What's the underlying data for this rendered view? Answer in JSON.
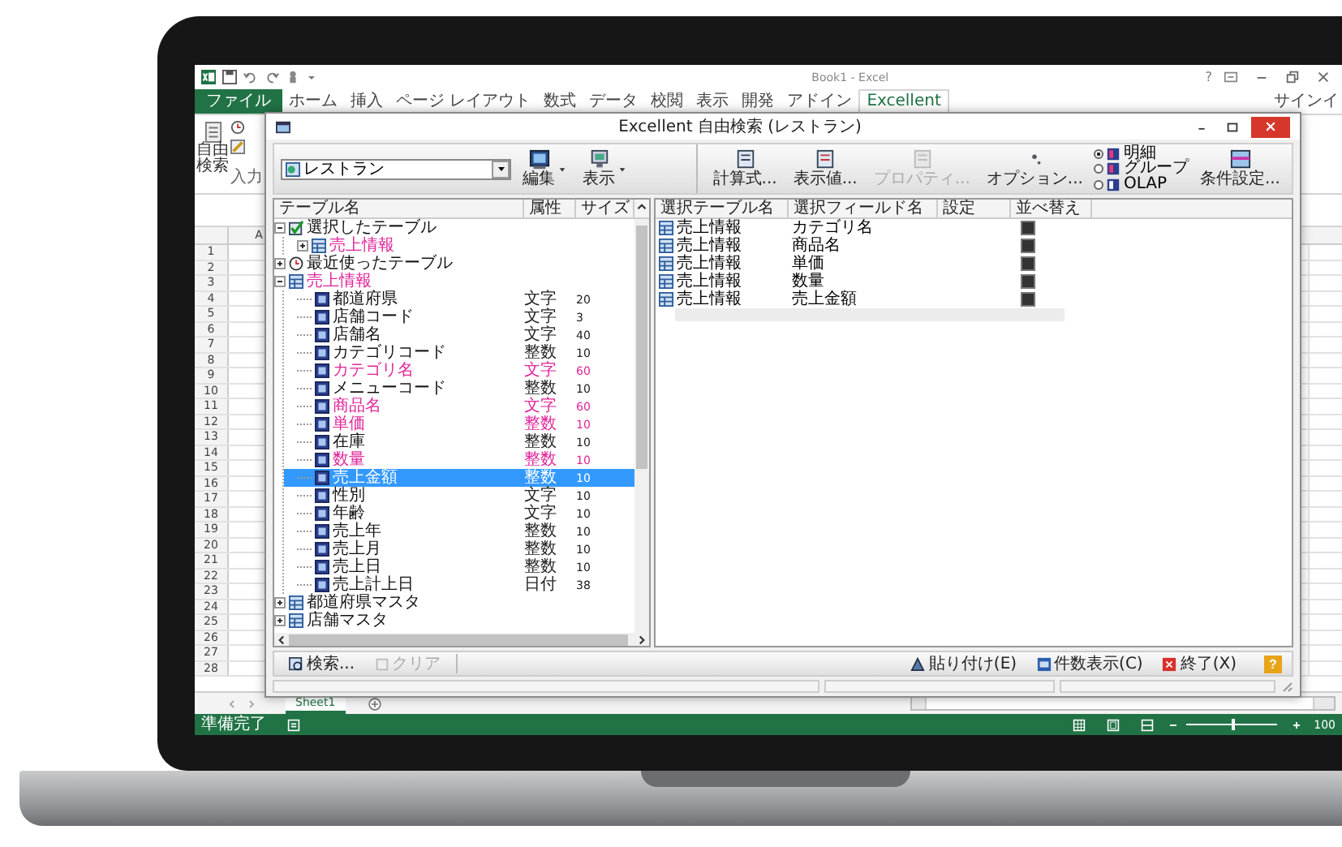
{
  "excel": {
    "title": "Book1 - Excel",
    "help": "?",
    "signin": "サインイ",
    "tabs": [
      {
        "label": "ファイル",
        "kind": "file",
        "selected": false
      },
      {
        "label": "ホーム",
        "kind": "tab",
        "selected": false
      },
      {
        "label": "挿入",
        "kind": "tab",
        "selected": false
      },
      {
        "label": "ページ レイアウト",
        "kind": "tab",
        "selected": false
      },
      {
        "label": "数式",
        "kind": "tab",
        "selected": false
      },
      {
        "label": "データ",
        "kind": "tab",
        "selected": false
      },
      {
        "label": "校閲",
        "kind": "tab",
        "selected": false
      },
      {
        "label": "表示",
        "kind": "tab",
        "selected": false
      },
      {
        "label": "開発",
        "kind": "tab",
        "selected": false
      },
      {
        "label": "アドイン",
        "kind": "tab",
        "selected": false
      },
      {
        "label": "Excellent",
        "kind": "tab",
        "selected": true
      }
    ],
    "ribbon": {
      "button": "自由検索",
      "group_label": "入力"
    },
    "column_header": "A",
    "row_numbers": [
      "1",
      "2",
      "3",
      "4",
      "5",
      "6",
      "7",
      "8",
      "9",
      "10",
      "11",
      "12",
      "13",
      "14",
      "15",
      "16",
      "17",
      "18",
      "19",
      "20",
      "21",
      "22",
      "23",
      "24",
      "25",
      "26",
      "27",
      "28"
    ],
    "sheet_tabs": [
      {
        "label": "Sheet1",
        "selected": true
      }
    ],
    "status_bar": {
      "text": "準備完了",
      "zoom": "100",
      "level": 0.5
    }
  },
  "dialog": {
    "title": "Excellent 自由検索 (レストラン)",
    "source": {
      "value": "レストラン"
    },
    "toolbar_left": [
      {
        "label": "編集",
        "kind": "edit"
      },
      {
        "label": "表示",
        "kind": "view"
      }
    ],
    "toolbar_right": [
      {
        "label": "計算式...",
        "kind": "formula",
        "disabled": false
      },
      {
        "label": "表示値...",
        "kind": "values",
        "disabled": false
      },
      {
        "label": "プロパティ...",
        "kind": "property",
        "disabled": true
      },
      {
        "label": "オプション...",
        "kind": "option",
        "disabled": false
      }
    ],
    "modes": [
      {
        "label": "明細",
        "selected": true
      },
      {
        "label": "グループ",
        "selected": false
      },
      {
        "label": "OLAP",
        "selected": false
      }
    ],
    "condition_button": "条件設定...",
    "tree": {
      "columns": [
        "テーブル名",
        "属性",
        "サイズ"
      ],
      "nodes": [
        {
          "label": "選択したテーブル",
          "kind": "selection",
          "expanded": true,
          "used": false,
          "selected": false,
          "children": [
            {
              "label": "売上情報",
              "kind": "table",
              "expanded": false,
              "used": true,
              "selected": false
            }
          ]
        },
        {
          "label": "最近使ったテーブル",
          "kind": "recent",
          "expanded": false,
          "used": false,
          "selected": false
        },
        {
          "label": "売上情報",
          "kind": "table",
          "expanded": true,
          "used": true,
          "selected": false,
          "children": [
            {
              "label": "都道府県",
              "kind": "field",
              "type": "文字",
              "size": "20",
              "used": false,
              "selected": false
            },
            {
              "label": "店舗コード",
              "kind": "field",
              "type": "文字",
              "size": "3",
              "used": false,
              "selected": false
            },
            {
              "label": "店舗名",
              "kind": "field",
              "type": "文字",
              "size": "40",
              "used": false,
              "selected": false
            },
            {
              "label": "カテゴリコード",
              "kind": "field",
              "type": "整数",
              "size": "10",
              "used": false,
              "selected": false
            },
            {
              "label": "カテゴリ名",
              "kind": "field",
              "type": "文字",
              "size": "60",
              "used": true,
              "selected": false
            },
            {
              "label": "メニューコード",
              "kind": "field",
              "type": "整数",
              "size": "10",
              "used": false,
              "selected": false
            },
            {
              "label": "商品名",
              "kind": "field",
              "type": "文字",
              "size": "60",
              "used": true,
              "selected": false
            },
            {
              "label": "単価",
              "kind": "field",
              "type": "整数",
              "size": "10",
              "used": true,
              "selected": false
            },
            {
              "label": "在庫",
              "kind": "field",
              "type": "整数",
              "size": "10",
              "used": false,
              "selected": false
            },
            {
              "label": "数量",
              "kind": "field",
              "type": "整数",
              "size": "10",
              "used": true,
              "selected": false
            },
            {
              "label": "売上金額",
              "kind": "field",
              "type": "整数",
              "size": "10",
              "used": true,
              "selected": true
            },
            {
              "label": "性別",
              "kind": "field",
              "type": "文字",
              "size": "10",
              "used": false,
              "selected": false
            },
            {
              "label": "年齢",
              "kind": "field",
              "type": "文字",
              "size": "10",
              "used": false,
              "selected": false
            },
            {
              "label": "売上年",
              "kind": "field",
              "type": "整数",
              "size": "10",
              "used": false,
              "selected": false
            },
            {
              "label": "売上月",
              "kind": "field",
              "type": "整数",
              "size": "10",
              "used": false,
              "selected": false
            },
            {
              "label": "売上日",
              "kind": "field",
              "type": "整数",
              "size": "10",
              "used": false,
              "selected": false
            },
            {
              "label": "売上計上日",
              "kind": "field",
              "type": "日付",
              "size": "38",
              "used": false,
              "selected": false
            }
          ]
        },
        {
          "label": "都道府県マスタ",
          "kind": "table",
          "expanded": false,
          "used": false,
          "selected": false
        },
        {
          "label": "店舗マスタ",
          "kind": "table",
          "expanded": false,
          "used": false,
          "selected": false
        }
      ]
    },
    "selection_table": {
      "columns": [
        "選択テーブル名",
        "選択フィールド名",
        "設定",
        "並べ替え"
      ],
      "rows": [
        {
          "table": "売上情報",
          "field": "カテゴリ名"
        },
        {
          "table": "売上情報",
          "field": "商品名"
        },
        {
          "table": "売上情報",
          "field": "単価"
        },
        {
          "table": "売上情報",
          "field": "数量"
        },
        {
          "table": "売上情報",
          "field": "売上金額"
        }
      ]
    },
    "bottom_left": [
      {
        "label": "検索...",
        "kind": "search",
        "disabled": false
      },
      {
        "label": "クリア",
        "kind": "clear",
        "disabled": true
      }
    ],
    "bottom_right": [
      {
        "label": "貼り付け(E)",
        "kind": "paste"
      },
      {
        "label": "件数表示(C)",
        "kind": "count"
      },
      {
        "label": "終了(X)",
        "kind": "exit"
      }
    ],
    "help": "?"
  }
}
